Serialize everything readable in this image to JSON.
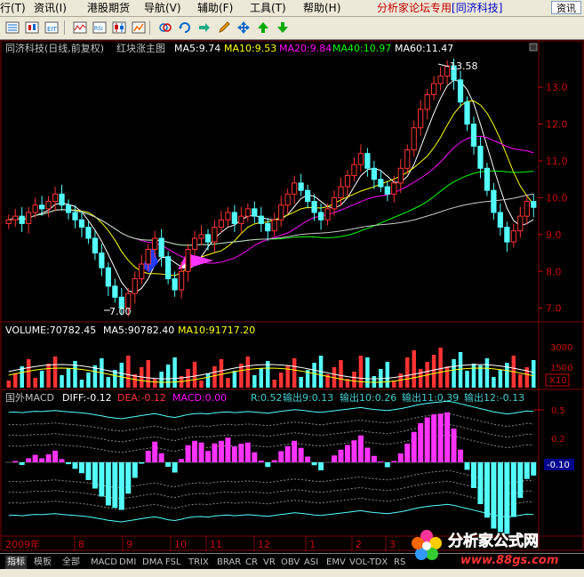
{
  "menu": {
    "items": [
      "行(T)",
      "资讯(I)",
      "港股期货",
      "导航(V)",
      "辅助(F)",
      "工具(T)",
      "帮助(H)"
    ],
    "forum_text": "分析家论坛专用",
    "stock_tag": "[同济科技]",
    "query_button": "资讯"
  },
  "toolbar": {
    "icons": [
      "list-icon",
      "k-line-icon",
      "exe-icon",
      "wave-icon",
      "rsi-icon",
      "candle-icon",
      "link-icon",
      "refresh-icon",
      "arrow-right-icon",
      "pencil-icon",
      "move-icon",
      "arrow-up-icon",
      "arrow-down-icon"
    ]
  },
  "main_chart": {
    "title": "同济科技(日线,前复权)",
    "indicator": "红块涨主图",
    "ma": [
      {
        "label": "MA5:9.74",
        "color": "#ffffff"
      },
      {
        "label": "MA10:9.53",
        "color": "#ffff00"
      },
      {
        "label": "MA20:9.84",
        "color": "#ff00ff"
      },
      {
        "label": "MA40:10.97",
        "color": "#00ff00"
      },
      {
        "label": "MA60:11.47",
        "color": "#ffffff"
      }
    ],
    "high_label": "13.58",
    "low_label": "7.00",
    "y_ticks": [
      "13.0",
      "12.0",
      "11.0",
      "10.0",
      "9.0",
      "8.0",
      "7.0"
    ]
  },
  "volume_chart": {
    "volume_label": "VOLUME:70782.45",
    "ma5_label": "MA5:90782.40",
    "ma10_label": "MA10:91717.20",
    "y_ticks": [
      "3000",
      "1500"
    ],
    "unit": "X10"
  },
  "macd_chart": {
    "name": "国外MACD",
    "diff": "DIFF:-0.12",
    "dea": "DEA:-0.12",
    "macd": "MACD:0.00",
    "r": "R:0.52",
    "out9": "输出9:0.13",
    "out10": "输出10:0.26",
    "out11": "输出11:0.39",
    "out12": "输出12:-0.13",
    "y_ticks": [
      "0.5",
      "0.2",
      "-0.10"
    ]
  },
  "date_axis": {
    "year": "2009年",
    "months": [
      "8",
      "9",
      "10",
      "11",
      "12",
      "1",
      "2",
      "3"
    ]
  },
  "tabs": {
    "items": [
      "指标",
      "模板",
      "全部",
      "MACD",
      "DMI",
      "DMA",
      "FSL",
      "TRIX",
      "BRAR",
      "CR",
      "VR",
      "OBV",
      "ASI",
      "EMV",
      "VOL-TDX",
      "RS"
    ]
  },
  "watermark": {
    "title": "分析家公式网",
    "url": "www.88gs.com"
  },
  "chart_data": {
    "type": "candlestick",
    "title": "同济科技(日线,前复权)",
    "y_range": [
      6.8,
      13.8
    ],
    "close_series": [
      9.4,
      9.5,
      9.3,
      9.6,
      9.8,
      9.7,
      9.9,
      10.1,
      9.8,
      9.6,
      9.4,
      9.2,
      8.9,
      8.5,
      8.1,
      7.6,
      7.3,
      7.0,
      7.4,
      7.8,
      8.2,
      8.6,
      8.9,
      8.4,
      7.8,
      7.5,
      8.0,
      8.6,
      8.9,
      9.0,
      8.8,
      9.2,
      9.4,
      9.6,
      9.3,
      9.5,
      9.7,
      9.5,
      9.3,
      9.1,
      9.4,
      9.8,
      10.1,
      10.4,
      10.2,
      9.9,
      9.6,
      9.4,
      9.7,
      10.0,
      10.3,
      10.6,
      10.9,
      11.2,
      10.8,
      10.5,
      10.3,
      10.1,
      10.4,
      10.8,
      11.3,
      11.9,
      12.4,
      12.8,
      13.1,
      13.3,
      13.58,
      13.2,
      12.6,
      12.0,
      11.4,
      10.8,
      10.2,
      9.6,
      9.2,
      8.8,
      9.1,
      9.5,
      9.9,
      9.74
    ],
    "ma_values": {
      "MA5": 9.74,
      "MA10": 9.53,
      "MA20": 9.84,
      "MA40": 10.97,
      "MA60": 11.47
    },
    "high": 13.58,
    "low": 7.0,
    "volume": {
      "VOLUME": 70782.45,
      "MA5": 90782.4,
      "MA10": 91717.2
    },
    "macd": {
      "DIFF": -0.12,
      "DEA": -0.12,
      "MACD": 0.0,
      "R": 0.52,
      "输出9": 0.13,
      "输出10": 0.26,
      "输出11": 0.39,
      "输出12": -0.13
    }
  }
}
